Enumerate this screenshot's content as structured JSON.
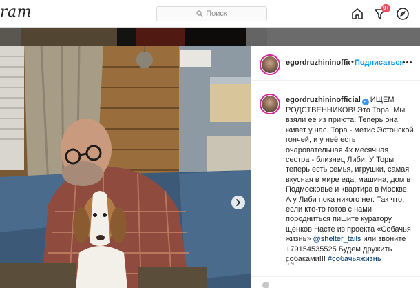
{
  "header": {
    "logo_text": "ram",
    "search_placeholder": "Поиск",
    "notification_count": "9+",
    "icons": [
      "home-icon",
      "activity-icon",
      "explore-icon"
    ]
  },
  "post": {
    "username": "egordruzhininofficial",
    "username_truncated": "egordruzhininoffici",
    "follow_label": "Подписаться",
    "separator": "•",
    "verified": true,
    "caption_text": "ИЩЕМ РОДСТВЕННИКОВ! Это Тора. Мы взяли ее из приюта. Теперь она живет у нас. Тора - метис Эстонской гончей, и у неё есть очаровательная 4х месячная сестра - близнец Либи. У Торы теперь есть семья, игрушки, самая вкусная в мире еда, машина, дом в Подмосковье и квартира в Москве. А у Либи пока никого нет. Так что, если кто-то готов с нами породниться пишите куратору щенков Насте из проекта «Собачья жизнь» ",
    "mention": "@shelter_tails",
    "caption_after_mention": " или звоните +79154535525 Будем дружить собаками!!! ",
    "hashtag": "#собачьяжизнь",
    "time_ago": "5 ч."
  },
  "colors": {
    "accent": "#0095f6",
    "badge": "#ed4956",
    "ring": "#d6249f"
  }
}
